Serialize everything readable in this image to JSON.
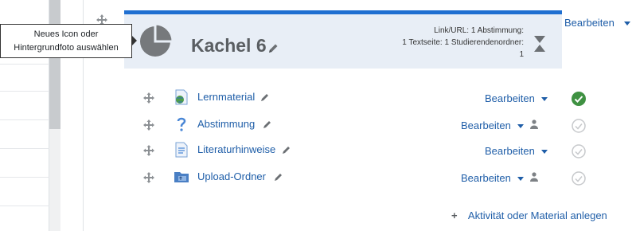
{
  "tooltip": {
    "text_line1": "Neues Icon oder",
    "text_line2": "Hintergrundfoto auswählen"
  },
  "tile": {
    "title": "Kachel 6",
    "stats_line1": "Link/URL: 1 Abstimmung:",
    "stats_line2": "1 Textseite: 1 Studierendenordner:",
    "stats_line3": "1",
    "edit_label": "Bearbeiten",
    "icon": "pie-chart-icon",
    "accent_color": "#1f6fd1"
  },
  "activities": [
    {
      "name": "Lernmaterial",
      "icon": "web-page-icon",
      "edit_label": "Bearbeiten",
      "restricted": false,
      "completed": true
    },
    {
      "name": "Abstimmung",
      "icon": "question-icon",
      "edit_label": "Bearbeiten",
      "restricted": true,
      "completed": false
    },
    {
      "name": "Literaturhinweise",
      "icon": "text-page-icon",
      "edit_label": "Bearbeiten",
      "restricted": false,
      "completed": false
    },
    {
      "name": "Upload-Ordner",
      "icon": "folder-upload-icon",
      "edit_label": "Bearbeiten",
      "restricted": true,
      "completed": false
    }
  ],
  "add_activity_label": "Aktivität oder Material anlegen",
  "colors": {
    "link": "#1f5ea8",
    "complete": "#3f9142",
    "incomplete": "#c7c9cc"
  }
}
